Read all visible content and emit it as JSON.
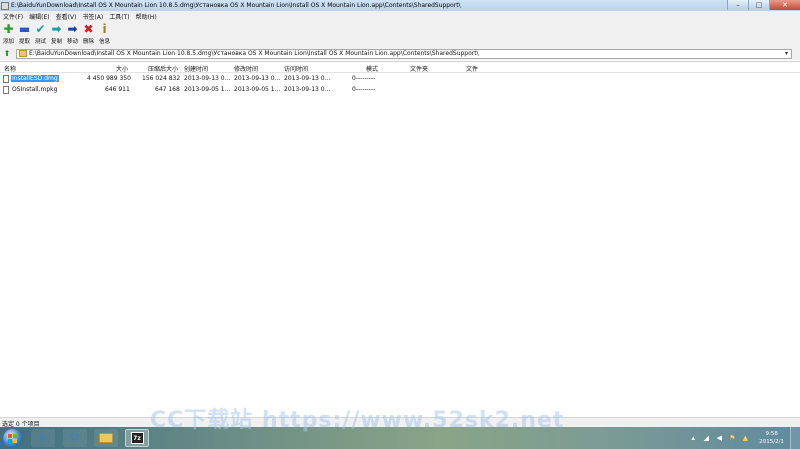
{
  "window": {
    "title": "E:\\BaiduYunDownload\\Install OS X Mountain Lion 10.8.5.dmg\\Установка OS X Mountain Lion\\Install OS X Mountain Lion.app\\Contents\\SharedSupport\\",
    "min_glyph": "–",
    "max_glyph": "□",
    "close_glyph": "✕"
  },
  "menu": [
    "文件(F)",
    "编辑(E)",
    "查看(V)",
    "书签(A)",
    "工具(T)",
    "帮助(H)"
  ],
  "toolbar": [
    {
      "label": "添加",
      "icon": "add-icon",
      "glyph": "✚",
      "color": "#22a022"
    },
    {
      "label": "提取",
      "icon": "extract-icon",
      "glyph": "▬",
      "color": "#2a56c8"
    },
    {
      "label": "测试",
      "icon": "test-icon",
      "glyph": "✔",
      "color": "#22a0a0"
    },
    {
      "label": "复制",
      "icon": "copy-icon",
      "glyph": "➡",
      "color": "#1aa0a0"
    },
    {
      "label": "移动",
      "icon": "move-icon",
      "glyph": "➡",
      "color": "#1a3fa0"
    },
    {
      "label": "删除",
      "icon": "delete-icon",
      "glyph": "✖",
      "color": "#cc2020"
    },
    {
      "label": "信息",
      "icon": "info-icon",
      "glyph": "i",
      "color": "#a08020"
    }
  ],
  "address": {
    "path": "E:\\BaiduYunDownload\\Install OS X Mountain Lion 10.8.5.dmg\\Установка OS X Mountain Lion\\Install OS X Mountain Lion.app\\Contents\\SharedSupport\\"
  },
  "columns": [
    "名称",
    "大小",
    "压缩后大小",
    "创建时间",
    "修改时间",
    "访问时间",
    "模式",
    "文件夹",
    "文件"
  ],
  "files": [
    {
      "name": "InstallESD.dmg",
      "size": "4 450 989 350",
      "packed": "156 024 832",
      "created": "2013-09-13 0...",
      "modified": "2013-09-13 0...",
      "accessed": "2013-09-13 0...",
      "mode": "0---------",
      "folders": "",
      "files": "",
      "selected": true
    },
    {
      "name": "OSInstall.mpkg",
      "size": "646 911",
      "packed": "647 168",
      "created": "2013-09-05 1...",
      "modified": "2013-09-05 1...",
      "accessed": "2013-09-13 0...",
      "mode": "0---------",
      "folders": "",
      "files": "",
      "selected": false
    }
  ],
  "status": {
    "text": "选定 0 个项目"
  },
  "taskbar": {
    "apps": [
      {
        "name": "ie",
        "icon": "ie-icon"
      },
      {
        "name": "qq",
        "icon": "qq-icon"
      },
      {
        "name": "explorer",
        "icon": "folder-icon"
      },
      {
        "name": "7zip",
        "icon": "7zip-icon",
        "label": "7z"
      }
    ],
    "time": "9:58",
    "date": "2015/2/1"
  },
  "watermark": "CC下载站 https://www.52sk2.net"
}
